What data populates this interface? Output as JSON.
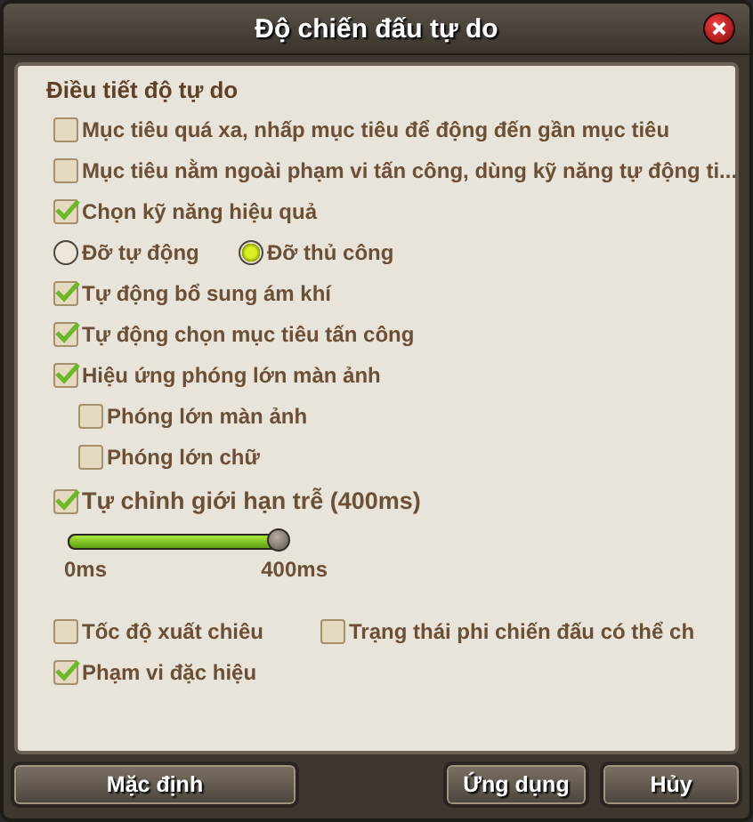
{
  "window": {
    "title": "Độ chiến đấu tự do"
  },
  "heading": "Điều tiết độ tự do",
  "items": [
    {
      "kind": "checkbox",
      "label": "Mục tiêu quá xa, nhấp mục tiêu để động đến gần mục tiêu",
      "checked": false
    },
    {
      "kind": "checkbox",
      "label": "Mục tiêu nằm ngoài phạm vi tấn công, dùng kỹ năng tự động ti...",
      "checked": false
    },
    {
      "kind": "checkbox",
      "label": "Chọn kỹ năng hiệu quả",
      "checked": true
    },
    {
      "kind": "radios",
      "options": [
        {
          "label": "Đỡ tự động",
          "selected": false
        },
        {
          "label": "Đỡ thủ công",
          "selected": true
        }
      ]
    },
    {
      "kind": "checkbox",
      "label": "Tự động bổ sung ám khí",
      "checked": true
    },
    {
      "kind": "checkbox",
      "label": "Tự động chọn mục tiêu tấn công",
      "checked": true
    },
    {
      "kind": "checkbox",
      "label": "Hiệu ứng phóng lớn màn ảnh",
      "checked": true,
      "children": [
        {
          "kind": "checkbox",
          "label": "Phóng lớn màn ảnh",
          "checked": false
        },
        {
          "kind": "checkbox",
          "label": "Phóng lớn chữ",
          "checked": false
        }
      ]
    },
    {
      "kind": "large-checkbox",
      "label": "Tự chỉnh giới hạn trễ (400ms)",
      "checked": true
    },
    {
      "kind": "slider",
      "level": 1,
      "min_label": "0ms",
      "max_label": "400ms"
    },
    {
      "kind": "pair",
      "options": [
        {
          "label": "Tốc độ xuất chiêu",
          "checked": false
        },
        {
          "label": "Trạng thái phi chiến đấu có thể ch",
          "checked": false
        }
      ]
    },
    {
      "kind": "checkbox",
      "label": "Phạm vi đặc hiệu",
      "checked": true
    }
  ],
  "buttons": [
    "Mặc định",
    "Ứng dụng",
    "Hủy"
  ]
}
